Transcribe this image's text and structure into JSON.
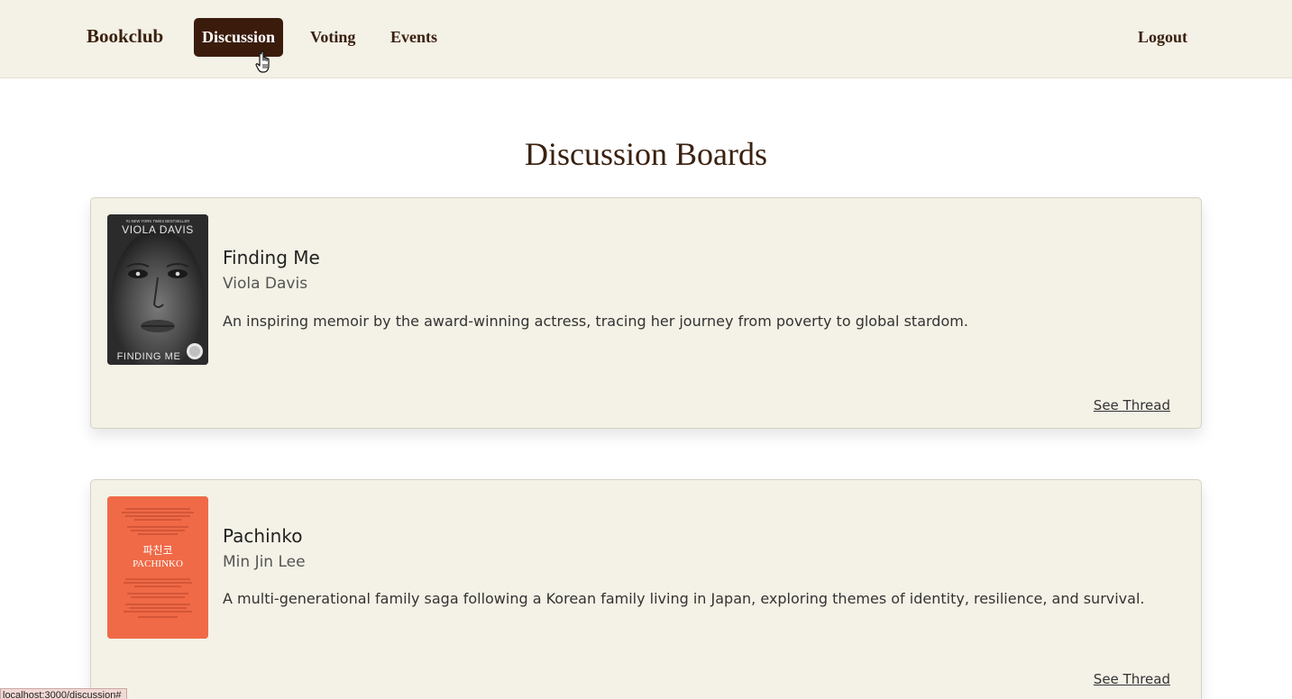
{
  "nav": {
    "brand": "Bookclub",
    "links": [
      {
        "label": "Discussion",
        "active": true
      },
      {
        "label": "Voting",
        "active": false
      },
      {
        "label": "Events",
        "active": false
      }
    ],
    "logout": "Logout"
  },
  "page": {
    "title": "Discussion Boards"
  },
  "books": [
    {
      "title": "Finding Me",
      "author": "Viola Davis",
      "description": "An inspiring memoir by the award-winning actress, tracing her journey from poverty to global stardom.",
      "link": "See Thread",
      "cover": {
        "top_text": "VIOLA DAVIS",
        "tagline": "#1 NEW YORK TIMES BESTSELLER",
        "bottom_text": "FINDING ME",
        "color": "#2b2b2b"
      }
    },
    {
      "title": "Pachinko",
      "author": "Min Jin Lee",
      "description": "A multi-generational family saga following a Korean family living in Japan, exploring themes of identity, resilience, and survival.",
      "link": "See Thread",
      "cover": {
        "korean_text": "파친코",
        "title_text": "PACHINKO",
        "color": "#f06a47"
      }
    }
  ],
  "status_bar": {
    "url": "localhost:3000/discussion#"
  },
  "colors": {
    "nav_bg": "#f4f1e6",
    "brand_brown": "#3b1c0c",
    "card_bg": "#f4f1e6"
  }
}
